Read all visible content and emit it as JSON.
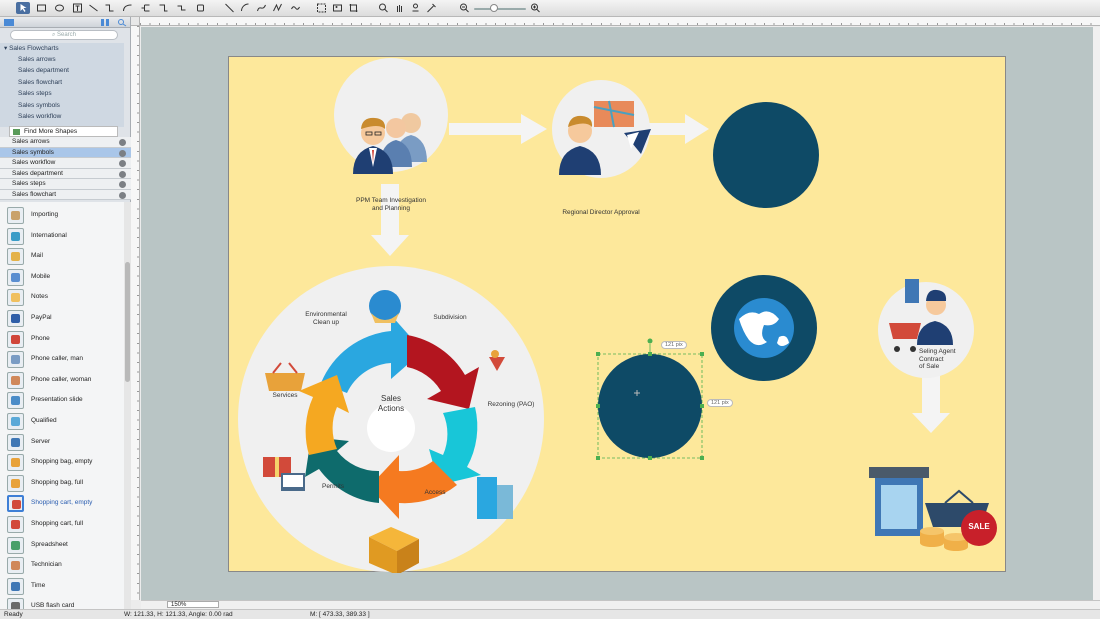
{
  "toolbar": {
    "tools": [
      "select",
      "rectangle",
      "ellipse",
      "text",
      "connector",
      "smart-connector",
      "curve",
      "arc",
      "polyline",
      "clone",
      "hand",
      "zoom-in",
      "zoom-out"
    ]
  },
  "sidebar": {
    "search_placeholder": "Search",
    "tree_category": "Sales Flowcharts",
    "tree_items": [
      "Sales arrows",
      "Sales department",
      "Sales flowchart",
      "Sales steps",
      "Sales symbols",
      "Sales workflow"
    ],
    "find_more": "Find More Shapes",
    "libraries": [
      "Sales arrows",
      "Sales symbols",
      "Sales workflow",
      "Sales department",
      "Sales steps",
      "Sales flowchart"
    ],
    "selected_library": "Sales symbols",
    "shapes": [
      {
        "label": "Importing",
        "color": "#c9a26b"
      },
      {
        "label": "International",
        "color": "#3a9cc7"
      },
      {
        "label": "Mail",
        "color": "#e4b24a"
      },
      {
        "label": "Mobile",
        "color": "#5a8ed0"
      },
      {
        "label": "Notes",
        "color": "#f0c060"
      },
      {
        "label": "PayPal",
        "color": "#2e5ea8"
      },
      {
        "label": "Phone",
        "color": "#d0463a"
      },
      {
        "label": "Phone caller, man",
        "color": "#7a9cc4"
      },
      {
        "label": "Phone caller, woman",
        "color": "#d0885a"
      },
      {
        "label": "Presentation slide",
        "color": "#4a8cc8"
      },
      {
        "label": "Qualified",
        "color": "#5aa9d8"
      },
      {
        "label": "Server",
        "color": "#3f77b5"
      },
      {
        "label": "Shopping bag, empty",
        "color": "#e8a23a"
      },
      {
        "label": "Shopping bag, full",
        "color": "#e8a23a"
      },
      {
        "label": "Shopping cart, empty",
        "color": "#d24a3a"
      },
      {
        "label": "Shopping cart, full",
        "color": "#d24a3a"
      },
      {
        "label": "Spreadsheet",
        "color": "#4aa06a"
      },
      {
        "label": "Technician",
        "color": "#d0885a"
      },
      {
        "label": "Time",
        "color": "#3f77b5"
      },
      {
        "label": "USB flash card",
        "color": "#6a6a6a"
      }
    ],
    "selected_shape": "Shopping cart, empty"
  },
  "diagram": {
    "ppm_label_1": "PPM Team Investigation",
    "ppm_label_2": "and Planning",
    "regional_label": "Regional Director Approval",
    "cycle_center_1": "Sales",
    "cycle_center_2": "Actions",
    "cycle_labels": {
      "environmental_1": "Environmental",
      "environmental_2": "Clean up",
      "subdivision": "Subdivision",
      "rezoning": "Rezoning (PAO)",
      "access": "Access",
      "permits": "Permits",
      "services": "Services"
    },
    "agent_label_1": "Seling Agent",
    "agent_label_2": "Contract",
    "agent_label_3": "of Sale",
    "sale_badge": "SALE",
    "dim_width": "121 pix",
    "dim_height": "121 pix"
  },
  "colors": {
    "page_bg": "#fde89b",
    "canvas_bg": "#b9c5c5",
    "dark_circle": "#0e4a66",
    "cycle_blue": "#2aa7e0",
    "cycle_red": "#b3151f",
    "cycle_cyan": "#18c6d8",
    "cycle_orange": "#f57a20",
    "cycle_teal": "#0e6b6c",
    "cycle_yellow": "#f5a821",
    "selection": "#4caf50"
  },
  "status": {
    "ready": "Ready",
    "dimensions": "W: 121.33,  H: 121.33,  Angle: 0.00 rad",
    "mouse": "M: [ 473.33, 389.33 ]",
    "zoom": "150%"
  }
}
